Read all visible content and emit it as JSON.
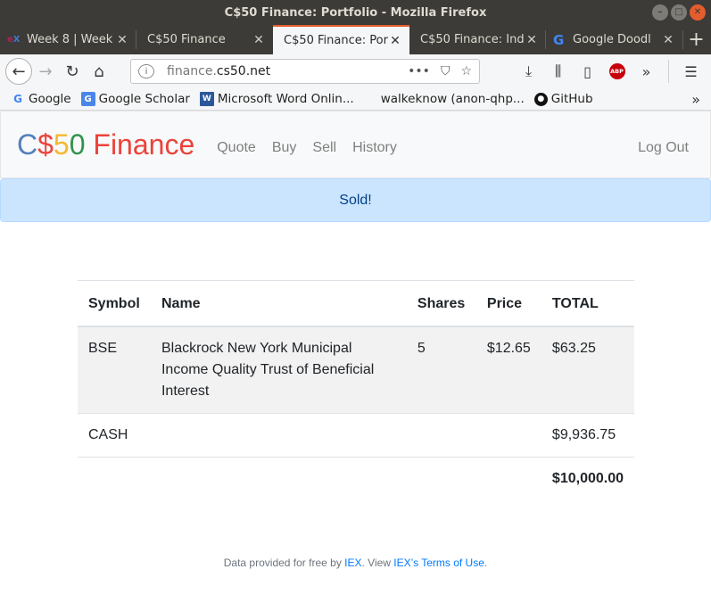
{
  "window": {
    "title": "C$50 Finance: Portfolio - Mozilla Firefox"
  },
  "tabs": [
    {
      "label": "Week 8 | Week",
      "icon": "edx-icon",
      "icon_text": "edX",
      "active": false
    },
    {
      "label": "C$50 Finance",
      "icon": "",
      "icon_text": "",
      "active": false
    },
    {
      "label": "C$50 Finance: Por",
      "icon": "",
      "icon_text": "",
      "active": true
    },
    {
      "label": "C$50 Finance: Ind",
      "icon": "",
      "icon_text": "",
      "active": false
    },
    {
      "label": "Google Doodl",
      "icon": "google-icon",
      "icon_text": "G",
      "active": false
    }
  ],
  "urlbar": {
    "host_prefix": "finance.",
    "host": "cs50.net",
    "more_label": "•••"
  },
  "bookmarks": [
    {
      "label": "Google",
      "icon": "google-icon"
    },
    {
      "label": "Google Scholar",
      "icon": "google-scholar-icon"
    },
    {
      "label": "Microsoft Word Onlin...",
      "icon": "word-icon"
    },
    {
      "label": "walkeknow (anon-qhp...",
      "icon": "microsoft-icon"
    },
    {
      "label": "GitHub",
      "icon": "github-icon"
    }
  ],
  "site": {
    "brand": {
      "c": "C",
      "dollar": "$",
      "five": "5",
      "zero": "0",
      "finance": " Finance"
    },
    "nav": [
      "Quote",
      "Buy",
      "Sell",
      "History"
    ],
    "logout": "Log Out",
    "alert": "Sold!",
    "colors": {
      "blue": "#537fbe",
      "red": "#ea433b",
      "yellow": "#f5b82e",
      "green": "#2e944b",
      "alert_bg": "#cce5ff",
      "alert_text": "#004085",
      "link": "#007bff"
    }
  },
  "portfolio": {
    "headers": [
      "Symbol",
      "Name",
      "Shares",
      "Price",
      "TOTAL"
    ],
    "rows": [
      {
        "symbol": "BSE",
        "name": "Blackrock New York Municipal Income Quality Trust of Beneficial Interest",
        "shares": "5",
        "price": "$12.65",
        "total": "$63.25"
      }
    ],
    "cash": {
      "label": "CASH",
      "total": "$9,936.75"
    },
    "grand_total": "$10,000.00"
  },
  "footer": {
    "prefix": "Data provided for free by ",
    "link1": "IEX",
    "middle": ". View ",
    "link2": "IEX’s Terms of Use",
    "suffix": "."
  }
}
